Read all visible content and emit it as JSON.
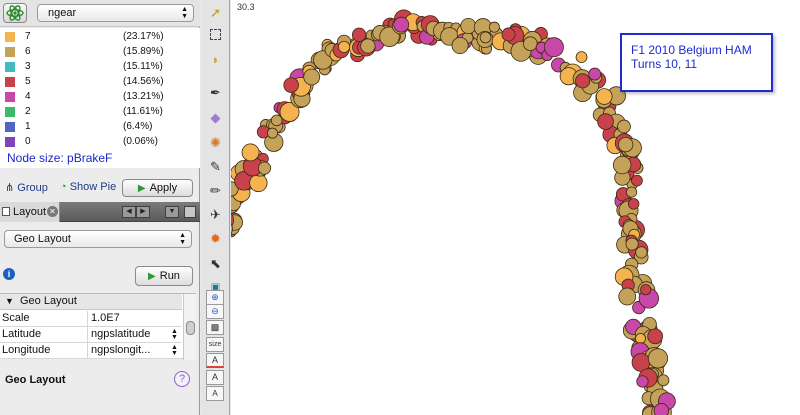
{
  "attribute_select": {
    "value": "ngear"
  },
  "legend": {
    "items": [
      {
        "label": "7",
        "pct": "(23.17%)",
        "color": "#f3b450"
      },
      {
        "label": "6",
        "pct": "(15.89%)",
        "color": "#c4a25a"
      },
      {
        "label": "3",
        "pct": "(15.11%)",
        "color": "#40bcbc"
      },
      {
        "label": "5",
        "pct": "(14.56%)",
        "color": "#c8414b"
      },
      {
        "label": "4",
        "pct": "(13.21%)",
        "color": "#c847a8"
      },
      {
        "label": "2",
        "pct": "(11.61%)",
        "color": "#3cba6e"
      },
      {
        "label": "1",
        "pct": "(6.4%)",
        "color": "#4d67c2"
      },
      {
        "label": "0",
        "pct": "(0.06%)",
        "color": "#7d44bb"
      }
    ],
    "node_size_label": "Node size: pBrakeF"
  },
  "actions": {
    "group_label": "Group",
    "show_pie_label": "Show Pie",
    "apply_label": "Apply"
  },
  "layout_tab": {
    "label": "Layout"
  },
  "layout_select": {
    "value": "Geo Layout"
  },
  "run_label": "Run",
  "properties": {
    "section": "Geo Layout",
    "rows": [
      {
        "key": "Scale",
        "value": "1.0E7"
      },
      {
        "key": "Latitude",
        "value": "ngpslatitude"
      },
      {
        "key": "Longitude",
        "value": "ngpslongit..."
      }
    ]
  },
  "bottom_title": "Geo Layout",
  "canvas": {
    "zoom_label": "30.3",
    "annotation_line1": "F1 2010 Belgium HAM",
    "annotation_line2": "Turns 10, 11"
  },
  "icons": {
    "toolbar": [
      "pointer-icon",
      "marquee-icon",
      "lasso-icon",
      "pen-icon",
      "gem-icon",
      "dial-icon",
      "brush-icon",
      "pencil-icon",
      "plane-icon",
      "gear-icon",
      "cursor-icon",
      "image-icon",
      "zoom-in-icon",
      "zoom-out-icon",
      "fill-icon",
      "size-icon",
      "text-color-icon",
      "text-icon",
      "text-size-icon"
    ]
  }
}
